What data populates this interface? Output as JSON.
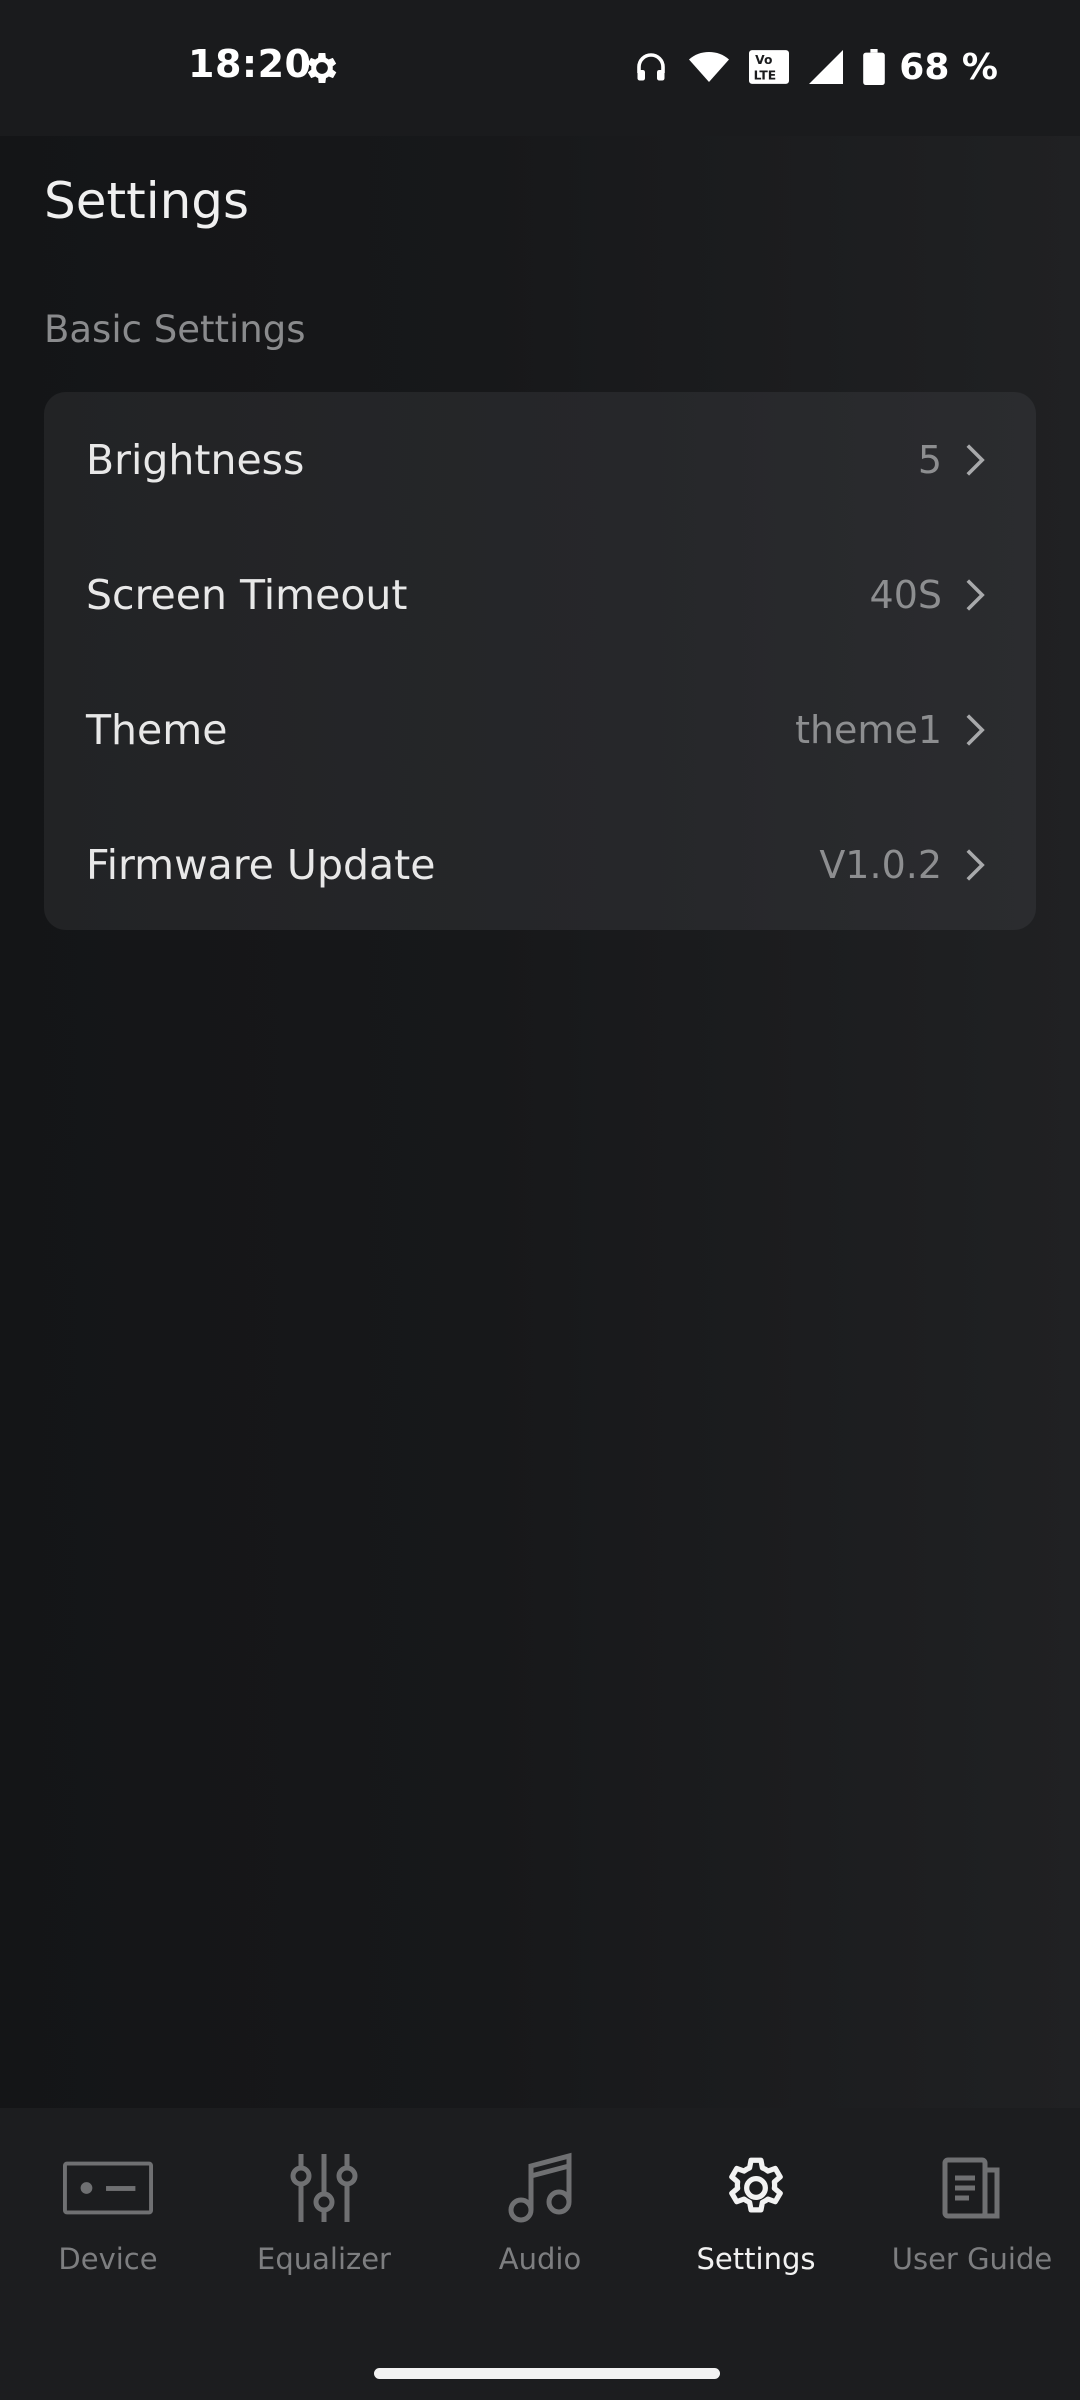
{
  "status_bar": {
    "time": "18:20",
    "battery": "68 %",
    "icons": [
      "gear-icon",
      "headphones-icon",
      "wifi-icon",
      "volte-icon",
      "signal-icon",
      "battery-icon"
    ]
  },
  "header": {
    "title": "Settings"
  },
  "basic_settings": {
    "section_label": "Basic Settings",
    "items": [
      {
        "label": "Brightness",
        "value": "5"
      },
      {
        "label": "Screen Timeout",
        "value": "40S"
      },
      {
        "label": "Theme",
        "value": "theme1"
      },
      {
        "label": "Firmware Update",
        "value": "V1.0.2"
      }
    ]
  },
  "bottom_nav": {
    "items": [
      {
        "label": "Device",
        "icon": "device-icon",
        "active": false
      },
      {
        "label": "Equalizer",
        "icon": "equalizer-icon",
        "active": false
      },
      {
        "label": "Audio",
        "icon": "music-note-icon",
        "active": false
      },
      {
        "label": "Settings",
        "icon": "gear-icon",
        "active": true
      },
      {
        "label": "User Guide",
        "icon": "document-icon",
        "active": false
      }
    ]
  },
  "colors": {
    "background": "#151618",
    "card": "#252628",
    "active": "#f2f2f2",
    "inactive": "#7d7e80"
  }
}
